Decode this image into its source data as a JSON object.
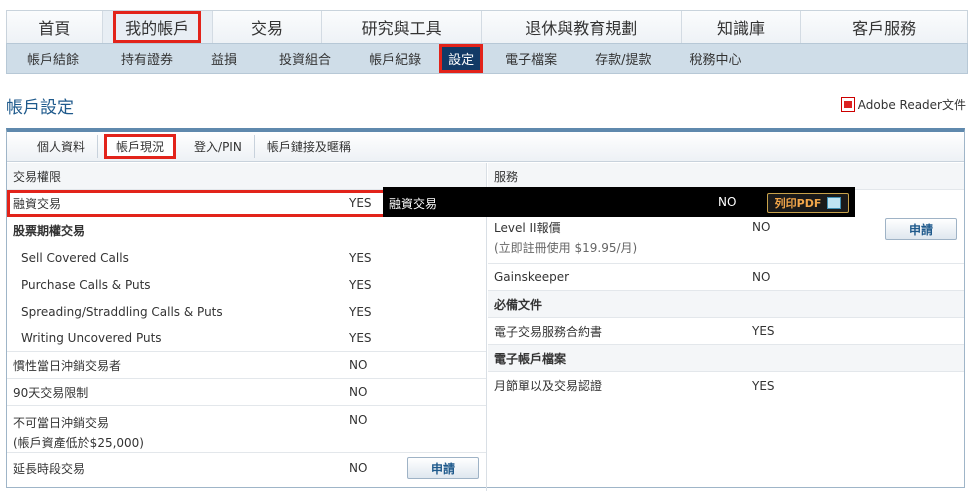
{
  "main_nav": [
    "首頁",
    "我的帳戶",
    "交易",
    "研究與工具",
    "退休與教育規劃",
    "知識庫",
    "客戶服務"
  ],
  "sub_nav": [
    "帳戶結餘",
    "持有證券",
    "益損",
    "投資組合",
    "帳戶紀錄",
    "設定",
    "電子檔案",
    "存款/提款",
    "稅務中心"
  ],
  "page_title": "帳戶設定",
  "adobe_link": "Adobe Reader文件",
  "tabs": [
    "個人資料",
    "帳戶現況",
    "登入/PIN",
    "帳戶鏈接及暱稱"
  ],
  "left": {
    "header": "交易權限",
    "rows": [
      {
        "label": "融資交易",
        "value": "YES"
      },
      {
        "label": "股票期權交易",
        "value": ""
      },
      {
        "label": "Sell Covered Calls",
        "value": "YES"
      },
      {
        "label": "Purchase Calls & Puts",
        "value": "YES"
      },
      {
        "label": "Spreading/Straddling Calls & Puts",
        "value": "YES"
      },
      {
        "label": "Writing Uncovered Puts",
        "value": "YES"
      },
      {
        "label": "慣性當日沖銷交易者",
        "value": "NO"
      },
      {
        "label": "90天交易限制",
        "value": "NO"
      },
      {
        "label": "不可當日沖銷交易",
        "label2": "(帳戶資產低於$25,000)",
        "value": "NO"
      },
      {
        "label": "延長時段交易",
        "value": "NO"
      }
    ],
    "apply_label": "申請"
  },
  "right": {
    "header": "服務",
    "rows": [
      {
        "label": "Level II報價",
        "label2": "(立即註冊使用 $19.95/月)",
        "value": "NO"
      },
      {
        "label": "Gainskeeper",
        "value": "NO"
      },
      {
        "label": "必備文件",
        "value": ""
      },
      {
        "label": "電子交易服務合約書",
        "value": "YES"
      },
      {
        "label": "電子帳戶檔案",
        "value": ""
      },
      {
        "label": "月節單以及交易認證",
        "value": "YES"
      }
    ],
    "apply_label": "申請"
  },
  "overlay": {
    "label": "融資交易",
    "value": "NO",
    "print_label": "列印PDF"
  }
}
